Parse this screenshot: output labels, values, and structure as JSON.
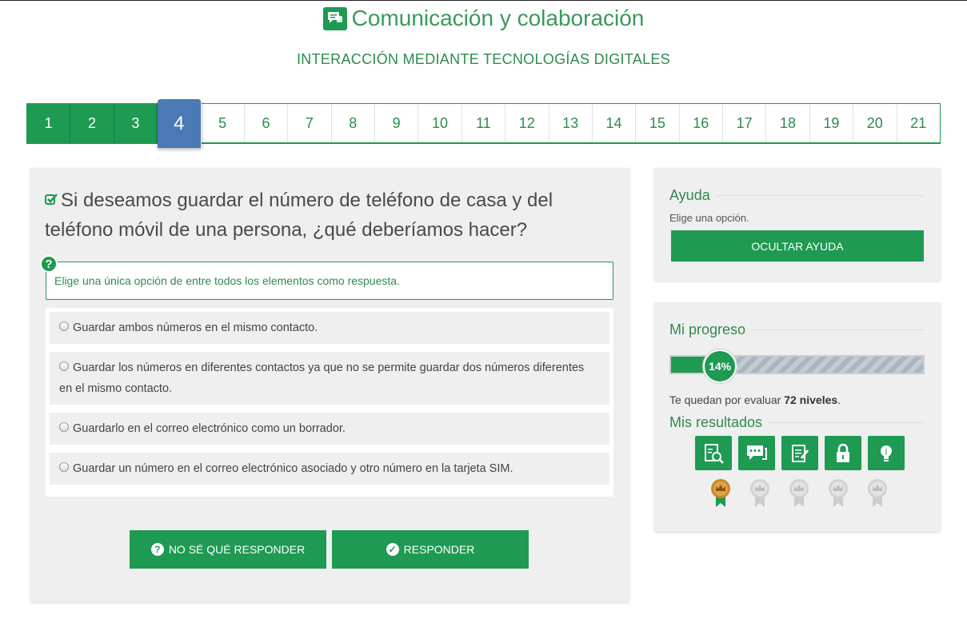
{
  "header": {
    "title": "Comunicación y colaboración",
    "subtitle": "INTERACCIÓN MEDIANTE TECNOLOGÍAS DIGITALES",
    "title_icon": "chat-bubbles-icon"
  },
  "levels": {
    "items": [
      "1",
      "2",
      "3",
      "4",
      "5",
      "6",
      "7",
      "8",
      "9",
      "10",
      "11",
      "12",
      "13",
      "14",
      "15",
      "16",
      "17",
      "18",
      "19",
      "20",
      "21"
    ],
    "completed": 3,
    "current": 4
  },
  "question": {
    "text": "Si deseamos guardar el número de teléfono de casa y del teléfono móvil de una persona, ¿qué deberíamos hacer?",
    "instruction": "Elige una única opción de entre todos los elementos como respuesta.",
    "options": [
      "Guardar ambos números en el mismo contacto.",
      "Guardar los números en diferentes contactos ya que no se permite guardar dos números diferentes en el mismo contacto.",
      "Guardarlo en el correo electrónico como un borrador.",
      "Guardar un número en el correo electrónico asociado y otro número en la tarjeta SIM."
    ],
    "dont_know_label": "NO SÉ QUÉ RESPONDER",
    "answer_label": "RESPONDER"
  },
  "help": {
    "heading": "Ayuda",
    "hint": "Elige una opción.",
    "hide_label": "OCULTAR AYUDA"
  },
  "progress": {
    "heading": "Mi progreso",
    "percent_label": "14%",
    "percent": 14,
    "remaining_prefix": "Te quedan por evaluar ",
    "remaining_count": "72 niveles",
    "remaining_suffix": ".",
    "results_heading": "Mis resultados",
    "result_icons": [
      "search-document-icon",
      "chat-icon",
      "edit-document-icon",
      "lock-icon",
      "lightbulb-icon"
    ],
    "medals": [
      "gold",
      "grey",
      "grey",
      "grey",
      "grey"
    ]
  },
  "colors": {
    "accent": "#1e9a52",
    "current_level": "#4a79b6",
    "text_green": "#2e8b4e"
  }
}
